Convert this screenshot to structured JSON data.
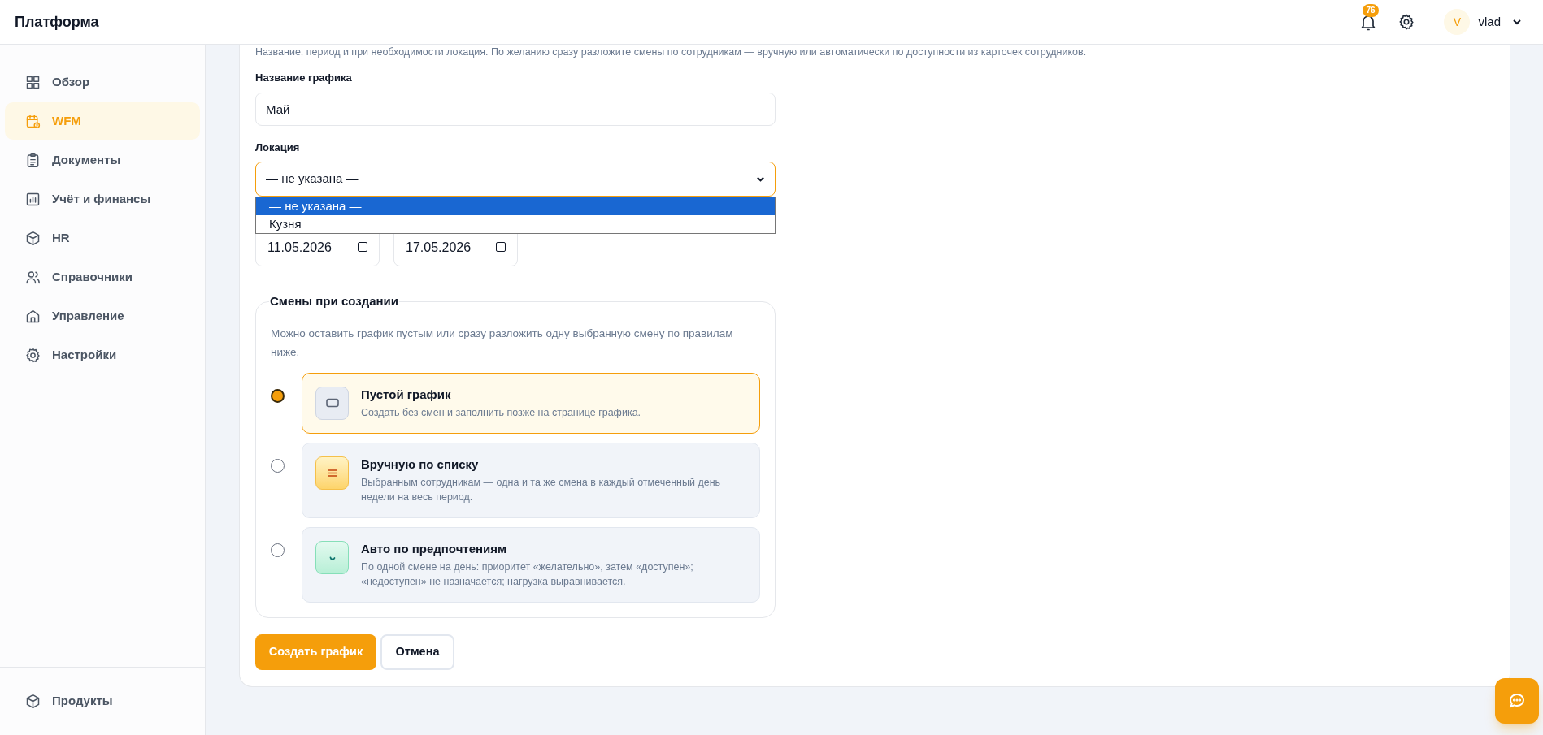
{
  "app": {
    "title": "Платформа"
  },
  "header": {
    "notification_count": "76",
    "avatar_letter": "V",
    "user": "vlad"
  },
  "sidebar": {
    "items": [
      {
        "label": "Обзор",
        "selected": false
      },
      {
        "label": "WFM",
        "selected": true
      },
      {
        "label": "Документы",
        "selected": false
      },
      {
        "label": "Учёт и финансы",
        "selected": false
      },
      {
        "label": "HR",
        "selected": false
      },
      {
        "label": "Справочники",
        "selected": false
      },
      {
        "label": "Управление",
        "selected": false
      },
      {
        "label": "Настройки",
        "selected": false
      }
    ],
    "footer_item": {
      "label": "Продукты"
    }
  },
  "form": {
    "description": "Название, период и при необходимости локация. По желанию сразу разложите смены по сотрудникам — вручную или автоматически по доступности из карточек сотрудников.",
    "name_field": {
      "label": "Название графика",
      "value": "Май"
    },
    "location": {
      "label": "Локация",
      "value": "— не указана —",
      "expanded": true,
      "options": [
        {
          "label": "— не указана —",
          "selected": true
        },
        {
          "label": "Кузня",
          "selected": false
        }
      ]
    },
    "dates": [
      {
        "value": "11.05.2026"
      },
      {
        "value": "17.05.2026"
      }
    ],
    "shifts": {
      "legend": "Смены при создании",
      "hint": "Можно оставить график пустым или сразу разложить одну выбранную смену по правилам ниже.",
      "options": [
        {
          "kind": "empty",
          "title": "Пустой график",
          "description": "Создать без смен и заполнить позже на странице графика.",
          "selected": true
        },
        {
          "kind": "manual",
          "title": "Вручную по списку",
          "description": "Выбранным сотрудникам — одна и та же смена в каждый отмеченный день недели на весь период.",
          "selected": false
        },
        {
          "kind": "auto",
          "title": "Авто по предпочтениям",
          "description": "По одной смене на день: приоритет «желательно», затем «доступен»; «недоступен» не назначается; нагрузка выравнивается.",
          "selected": false
        }
      ]
    },
    "buttons": [
      {
        "kind": "primary",
        "label": "Создать график"
      },
      {
        "kind": "secondary",
        "label": "Отмена"
      }
    ]
  }
}
